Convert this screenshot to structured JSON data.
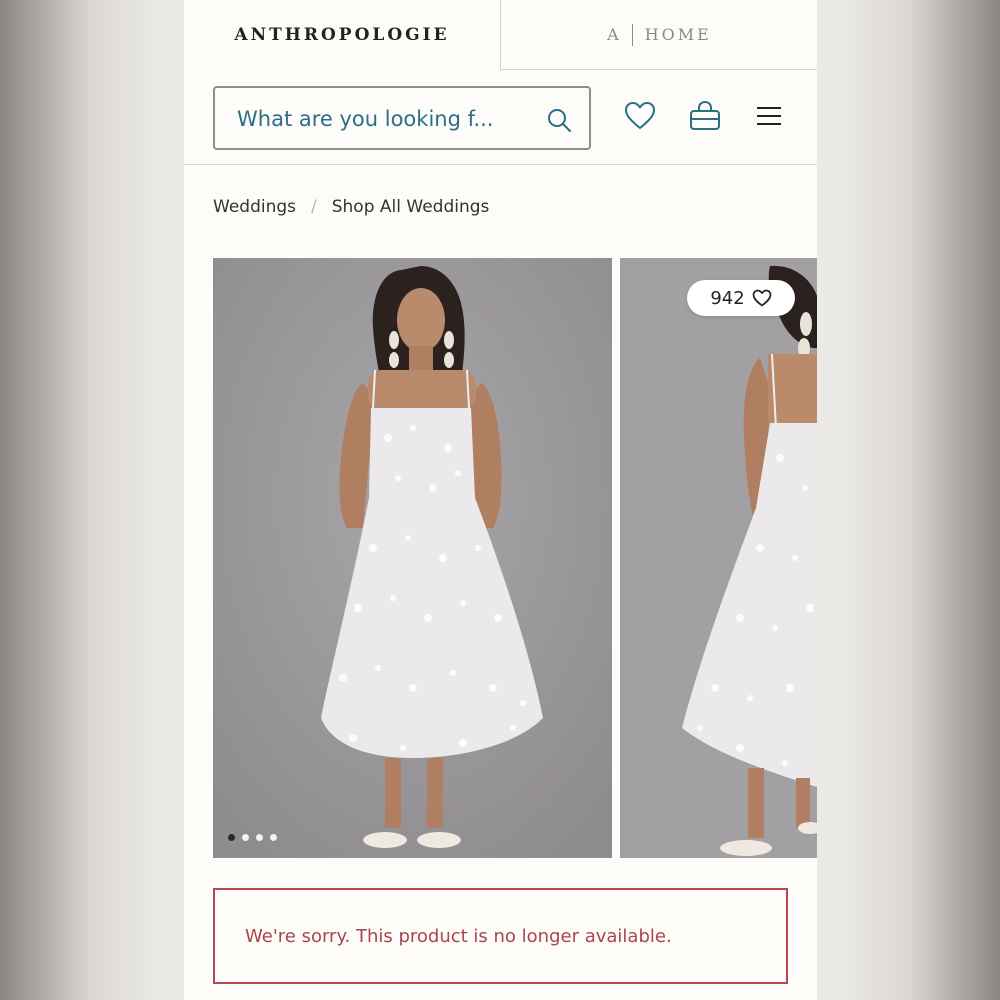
{
  "brand_tabs": {
    "anthropologie": "ANTHROPOLOGIE",
    "home_letter": "A",
    "home_label": "HOME"
  },
  "search": {
    "placeholder": "What are you looking f..."
  },
  "header_icons": [
    "search-icon",
    "heart-icon",
    "shopping-bag-icon",
    "hamburger-menu-icon"
  ],
  "breadcrumb": {
    "items": [
      "Weddings",
      "Shop All Weddings"
    ],
    "separator": "/"
  },
  "gallery": {
    "favorites_count": "942",
    "carousel_dots": 4,
    "active_dot": 1
  },
  "notice": {
    "message": "We're sorry. This product is no longer available."
  },
  "colors": {
    "accent_teal": "#2b6f86",
    "error_red": "#b7474d",
    "page_bg": "#fdfcf9"
  }
}
